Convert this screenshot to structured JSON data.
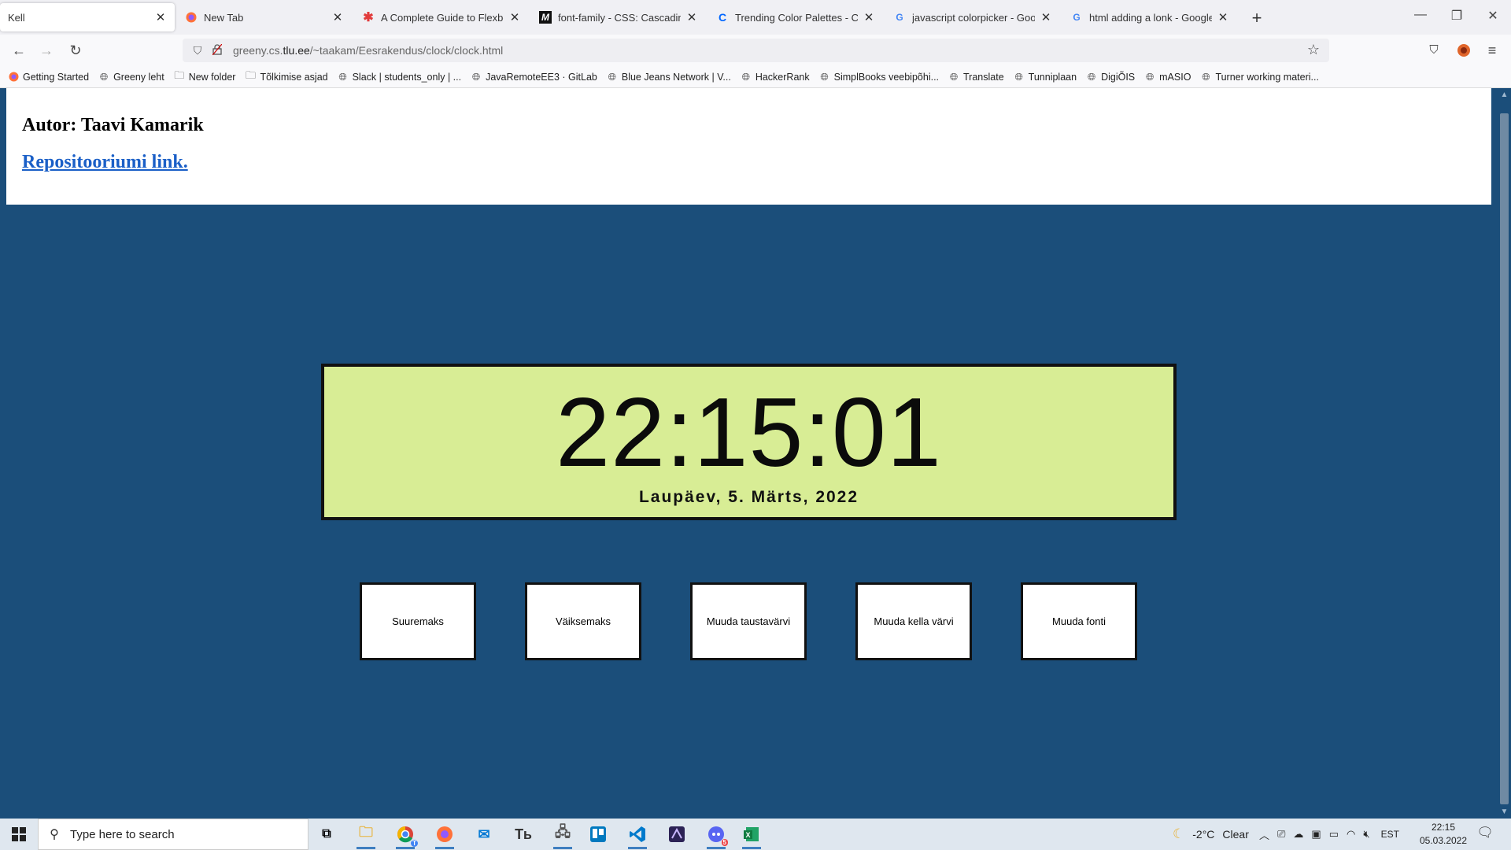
{
  "browser": {
    "tabs": [
      {
        "label": "Kell",
        "active": true
      },
      {
        "label": "New Tab"
      },
      {
        "label": "A Complete Guide to Flexbox | "
      },
      {
        "label": "font-family - CSS: Cascading St"
      },
      {
        "label": "Trending Color Palettes - Coolo"
      },
      {
        "label": "javascript colorpicker - Google "
      },
      {
        "label": "html adding a lonk - Google ot"
      }
    ],
    "url_prefix": "greeny.cs.",
    "url_host": "tlu.ee",
    "url_path": "/~taakam/Eesrakendus/clock/clock.html",
    "bookmarks": [
      {
        "label": "Getting Started",
        "icon": "firefox-icon"
      },
      {
        "label": "Greeny leht",
        "icon": "globe-icon"
      },
      {
        "label": "New folder",
        "icon": "folder-icon"
      },
      {
        "label": "Tõlkimise asjad",
        "icon": "folder-icon"
      },
      {
        "label": "Slack | students_only | ...",
        "icon": "globe-icon"
      },
      {
        "label": "JavaRemoteEE3 · GitLab",
        "icon": "globe-icon"
      },
      {
        "label": "Blue Jeans Network | V...",
        "icon": "globe-icon"
      },
      {
        "label": "HackerRank",
        "icon": "globe-icon"
      },
      {
        "label": "SimplBooks veebipõhi...",
        "icon": "globe-icon"
      },
      {
        "label": "Translate",
        "icon": "globe-icon"
      },
      {
        "label": "Tunniplaan",
        "icon": "globe-icon"
      },
      {
        "label": "DigiÕIS",
        "icon": "globe-icon"
      },
      {
        "label": "mASIO",
        "icon": "globe-icon"
      },
      {
        "label": "Turner working materi...",
        "icon": "globe-icon"
      }
    ]
  },
  "page": {
    "author": "Autor: Taavi Kamarik",
    "repo_link": "Repositooriumi link.",
    "clock": {
      "time": "22:15:01",
      "date": "Laupäev, 5. Märts, 2022"
    },
    "buttons": [
      "Suuremaks",
      "Väiksemaks",
      "Muuda taustavärvi",
      "Muuda kella värvi",
      "Muuda fonti"
    ]
  },
  "colors": {
    "page_background": "#1b4e7a",
    "clock_background": "#d8ed95",
    "link": "#1a5fc7"
  },
  "taskbar": {
    "search_placeholder": "Type here to search",
    "weather_temp": "-2°C",
    "weather_text": "Clear",
    "lang": "EST",
    "time": "22:15",
    "date": "05.03.2022",
    "chrome_badge": "T",
    "discord_badge": "5"
  }
}
